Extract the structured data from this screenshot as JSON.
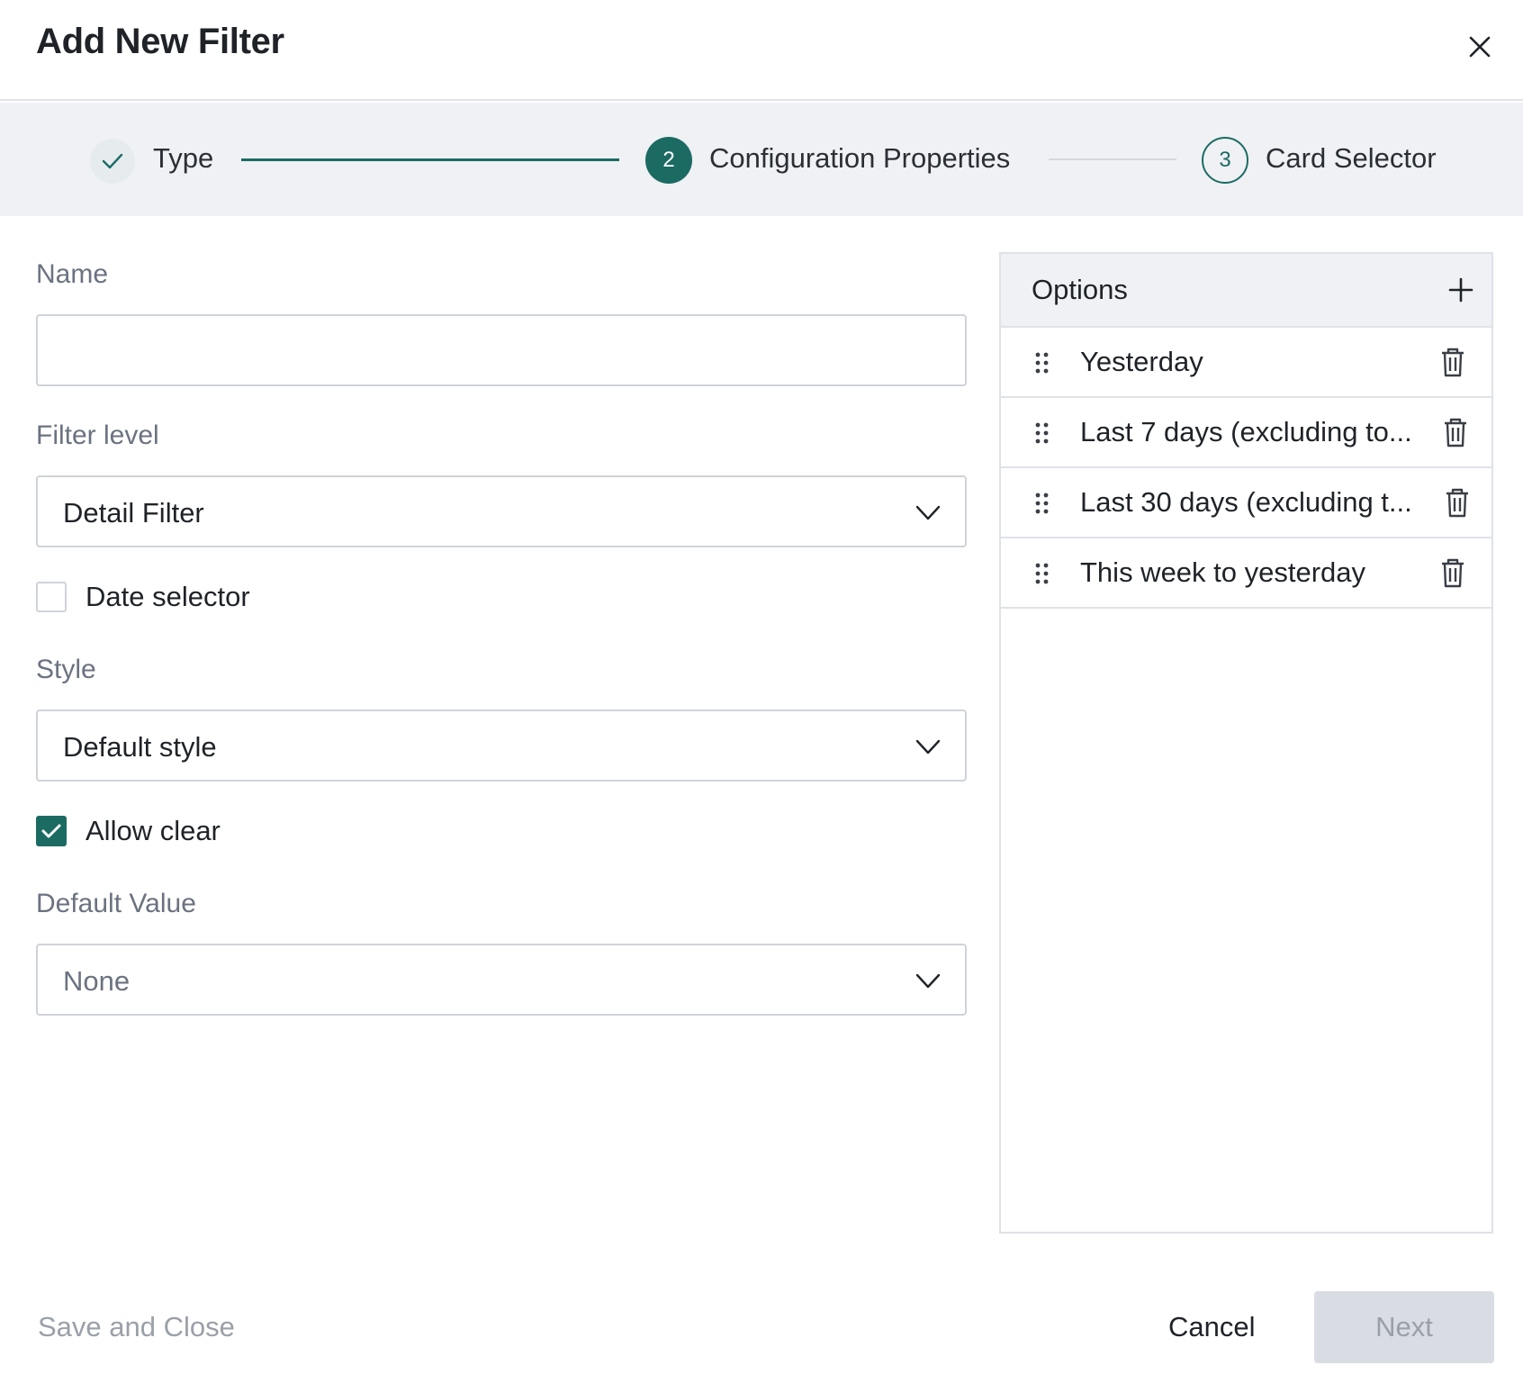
{
  "dialog": {
    "title": "Add New Filter"
  },
  "stepper": {
    "steps": [
      {
        "label": "Type",
        "state": "complete"
      },
      {
        "label": "Configuration Properties",
        "number": "2",
        "state": "active"
      },
      {
        "label": "Card Selector",
        "number": "3",
        "state": "upcoming"
      }
    ]
  },
  "form": {
    "name": {
      "label": "Name",
      "value": ""
    },
    "filter_level": {
      "label": "Filter level",
      "value": "Detail Filter"
    },
    "date_selector": {
      "label": "Date selector",
      "checked": false
    },
    "style": {
      "label": "Style",
      "value": "Default style"
    },
    "allow_clear": {
      "label": "Allow clear",
      "checked": true
    },
    "default_value": {
      "label": "Default Value",
      "value": "None"
    }
  },
  "options": {
    "title": "Options",
    "items": [
      {
        "label": "Yesterday"
      },
      {
        "label": "Last 7 days (excluding to..."
      },
      {
        "label": "Last 30 days (excluding t..."
      },
      {
        "label": "This week to yesterday"
      }
    ]
  },
  "footer": {
    "save_close_label": "Save and Close",
    "cancel_label": "Cancel",
    "next_label": "Next"
  },
  "colors": {
    "accent": "#1c6b63",
    "stepper_bg": "#eff1f5",
    "border": "#cfd3d9",
    "disabled_bg": "#d9dde3",
    "disabled_text": "#9aa0a8"
  }
}
